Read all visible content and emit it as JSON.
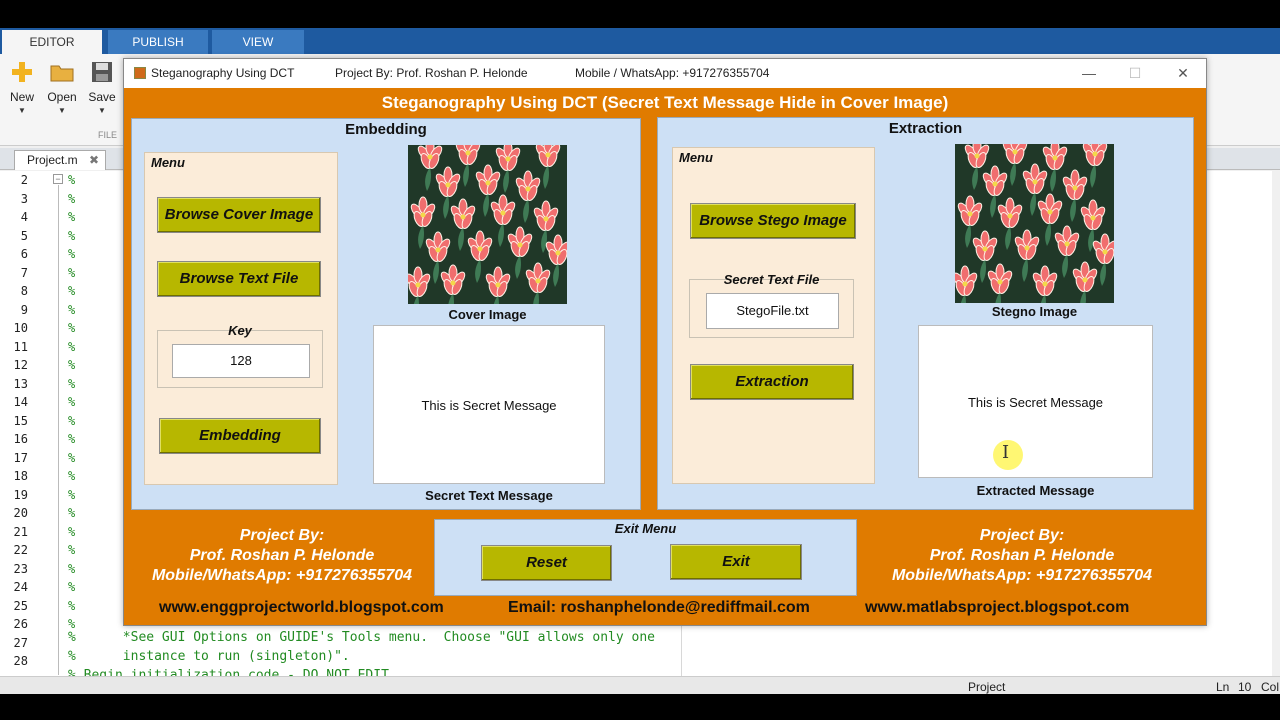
{
  "ribbon": {
    "tabs": [
      "EDITOR",
      "PUBLISH",
      "VIEW"
    ],
    "buttons": [
      {
        "label": "New",
        "icon": "new-icon"
      },
      {
        "label": "Open",
        "icon": "open-folder-icon"
      },
      {
        "label": "Save",
        "icon": "save-icon"
      }
    ],
    "section_label": "FILE"
  },
  "editor": {
    "tab_label": "Project.m",
    "close_glyph": "✖",
    "line_numbers": [
      "2",
      "3",
      "4",
      "5",
      "6",
      "7",
      "8",
      "9",
      "10",
      "11",
      "12",
      "13",
      "14",
      "15",
      "16",
      "17",
      "18",
      "19",
      "20",
      "21",
      "22",
      "23",
      "24",
      "25",
      "26",
      "27",
      "28"
    ],
    "comment_marker": "%",
    "line27_text": "%      *See GUI Options on GUIDE's Tools menu.  Choose \"GUI allows only one",
    "line28_text": "%      instance to run (singleton)\".",
    "line29_partial": "% Begin initialization code - DO NOT EDIT"
  },
  "statusbar": {
    "project": "Project",
    "ln": "Ln",
    "ln_value": "10",
    "col": "Col"
  },
  "window": {
    "title": "Steganography Using DCT",
    "project_by": "Project By: Prof. Roshan P. Helonde",
    "mobile": "Mobile / WhatsApp: +917276355704",
    "minimize": "—",
    "maximize": "☐",
    "close": "✕"
  },
  "gui": {
    "main_title": "Steganography Using DCT (Secret Text Message Hide in Cover Image)",
    "embedding": {
      "title": "Embedding",
      "menu_label": "Menu",
      "browse_cover": "Browse Cover Image",
      "browse_text": "Browse Text File",
      "key_label": "Key",
      "key_value": "128",
      "embed_button": "Embedding",
      "cover_caption": "Cover Image",
      "message": "This is Secret Message",
      "message_caption": "Secret Text Message"
    },
    "extraction": {
      "title": "Extraction",
      "menu_label": "Menu",
      "browse_stego": "Browse Stego Image",
      "secret_file_label": "Secret Text File",
      "secret_file_value": "StegoFile.txt",
      "extract_button": "Extraction",
      "stego_caption": "Stegno Image",
      "message": "This is Secret Message",
      "message_caption": "Extracted Message"
    },
    "footer": {
      "left_line1": "Project By:",
      "left_line2": "Prof. Roshan P. Helonde",
      "left_line3": "Mobile/WhatsApp: +917276355704",
      "right_line1": "Project By:",
      "right_line2": "Prof. Roshan P. Helonde",
      "right_line3": "Mobile/WhatsApp: +917276355704",
      "exit_menu_label": "Exit Menu",
      "reset_button": "Reset",
      "exit_button": "Exit",
      "site1": "www.enggprojectworld.blogspot.com",
      "email": "Email: roshanphelonde@rediffmail.com",
      "site2": "www.matlabsproject.blogspot.com"
    }
  },
  "colors": {
    "figure_bg": "#e07b00",
    "panel_bg": "#cde0f5",
    "menu_bg": "#fbecd9",
    "button_bg": "#b7b700"
  }
}
